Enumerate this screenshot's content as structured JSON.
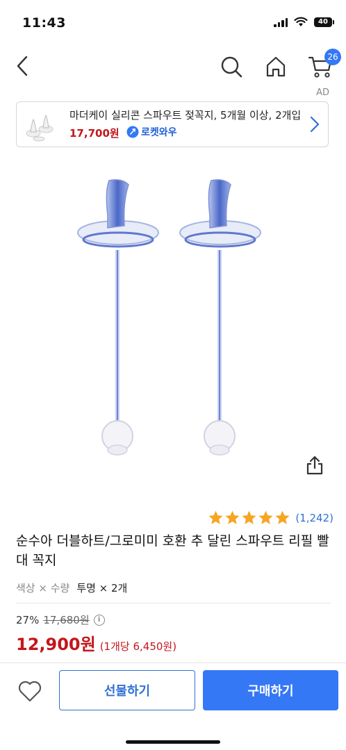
{
  "status_bar": {
    "time": "11:43",
    "battery": "40"
  },
  "nav": {
    "cart_count": "26"
  },
  "ad": {
    "label": "AD",
    "title": "마더케이 실리콘 스파우트 젖꼭지, 5개월 이상, 2개입",
    "price": "17,700원",
    "badge": "로켓와우"
  },
  "product": {
    "rating": 5,
    "review_count": "(1,242)",
    "title": "순수아 더블하트/그로미미 호환 추 달린 스파우트 리필 빨대 꼭지",
    "option_label": "색상 × 수량",
    "option_value": "투명 × 2개",
    "discount_rate": "27%",
    "original_price": "17,680원",
    "sale_price": "12,900원",
    "unit_price": "(1개당 6,450원)"
  },
  "actions": {
    "gift_label": "선물하기",
    "buy_label": "구매하기"
  },
  "colors": {
    "accent": "#3478f6",
    "price_red": "#c4161c",
    "star": "#f5a623"
  }
}
